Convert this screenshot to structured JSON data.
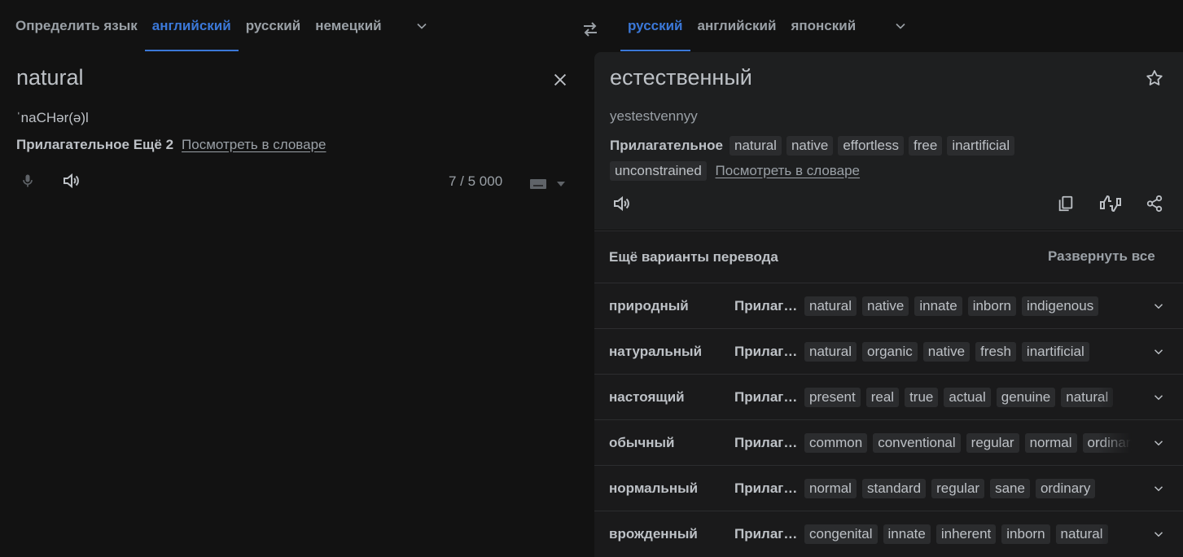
{
  "source_tabs": [
    {
      "label": "Определить язык",
      "active": false
    },
    {
      "label": "английский",
      "active": true
    },
    {
      "label": "русский",
      "active": false
    },
    {
      "label": "немецкий",
      "active": false
    }
  ],
  "target_tabs": [
    {
      "label": "русский",
      "active": true
    },
    {
      "label": "английский",
      "active": false
    },
    {
      "label": "японский",
      "active": false
    }
  ],
  "source": {
    "text": "natural",
    "transliteration": "ˈnaCHər(ə)l",
    "pos_label": "Прилагательное Ещё 2",
    "dictionary_link": "Посмотреть в словаре",
    "char_count": "7 / 5 000"
  },
  "target": {
    "text": "естественный",
    "transliteration": "yestestvennyy",
    "pos_label": "Прилагательное",
    "synonyms": [
      "natural",
      "native",
      "effortless",
      "free",
      "inartificial",
      "unconstrained"
    ],
    "dictionary_link": "Посмотреть в словаре"
  },
  "alternatives": {
    "header": "Ещё варианты перевода",
    "expand_all": "Развернуть все",
    "rows": [
      {
        "word": "природный",
        "pos": "Прилагательное",
        "chips": [
          "natural",
          "native",
          "innate",
          "inborn",
          "indigenous"
        ]
      },
      {
        "word": "натуральный",
        "pos": "Прилагательное",
        "chips": [
          "natural",
          "organic",
          "native",
          "fresh",
          "inartificial"
        ]
      },
      {
        "word": "настоящий",
        "pos": "Прилагательное",
        "chips": [
          "present",
          "real",
          "true",
          "actual",
          "genuine",
          "natural"
        ]
      },
      {
        "word": "обычный",
        "pos": "Прилагательное",
        "chips": [
          "common",
          "conventional",
          "regular",
          "normal",
          "ordinary"
        ]
      },
      {
        "word": "нормальный",
        "pos": "Прилагательное",
        "chips": [
          "normal",
          "standard",
          "regular",
          "sane",
          "ordinary"
        ]
      },
      {
        "word": "врожденный",
        "pos": "Прилагательное",
        "chips": [
          "congenital",
          "innate",
          "inherent",
          "inborn",
          "natural"
        ]
      }
    ]
  },
  "colors": {
    "accent": "#3b78d8",
    "background": "#121212",
    "panel": "#1e1f20",
    "chip": "#2b2c2e"
  },
  "icons": [
    "chevron-down-icon",
    "swap-icon",
    "close-icon",
    "mic-icon",
    "speaker-icon",
    "keyboard-icon",
    "star-icon",
    "copy-icon",
    "thumbs-rate-icon",
    "share-icon"
  ]
}
